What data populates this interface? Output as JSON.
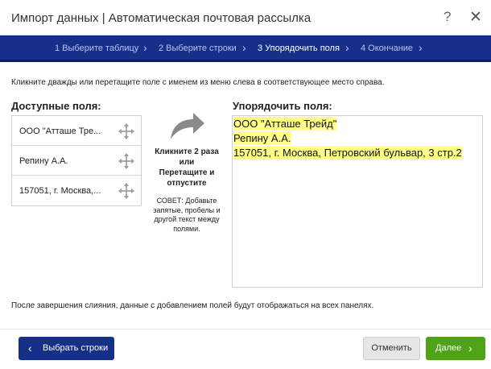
{
  "dialog": {
    "title": "Импорт данных | Автоматическая почтовая рассылка",
    "help_glyph": "?",
    "close_glyph": "✕"
  },
  "steps": [
    {
      "label": "1 Выберите таблицу",
      "active": false
    },
    {
      "label": "2 Выберите строки",
      "active": false
    },
    {
      "label": "3 Упорядочить поля",
      "active": true
    },
    {
      "label": "4 Окончание",
      "active": false
    }
  ],
  "instruction": "Кликните дважды или перетащите поле с именем из меню слева в соответствующее место справа.",
  "available": {
    "heading": "Доступные поля:",
    "items": [
      {
        "label": "ООО \"Атташе Тре...",
        "icon": "move-icon"
      },
      {
        "label": "Репину А.А.",
        "icon": "move-icon"
      },
      {
        "label": "157051, г. Москва,...",
        "icon": "move-icon"
      }
    ]
  },
  "middle": {
    "action_line1": "Кликните 2 раза",
    "action_line2": "или",
    "action_line3": "Перетащите и",
    "action_line4": "отпустите",
    "tip_line1": "СОВЕТ: Добавьте",
    "tip_line2": "запятые, пробелы и",
    "tip_line3": "другой текст между",
    "tip_line4": "полями."
  },
  "ordered": {
    "heading": "Упорядочить поля:",
    "lines": [
      "ООО \"Атташе Трейд\"",
      "Репину А.А.",
      "157051, г. Москва, Петровский бульвар, 3 стр.2"
    ],
    "highlight_color": "#ffff8a"
  },
  "footnote": "После завершения слияния, данные с добавлением полей будут отображаться на всех панелях.",
  "buttons": {
    "back": "Выбрать строки",
    "cancel": "Отменить",
    "next": "Далее"
  },
  "colors": {
    "steps_bar": "#16308a",
    "primary_button": "#16308a",
    "next_button": "#4ea316"
  }
}
